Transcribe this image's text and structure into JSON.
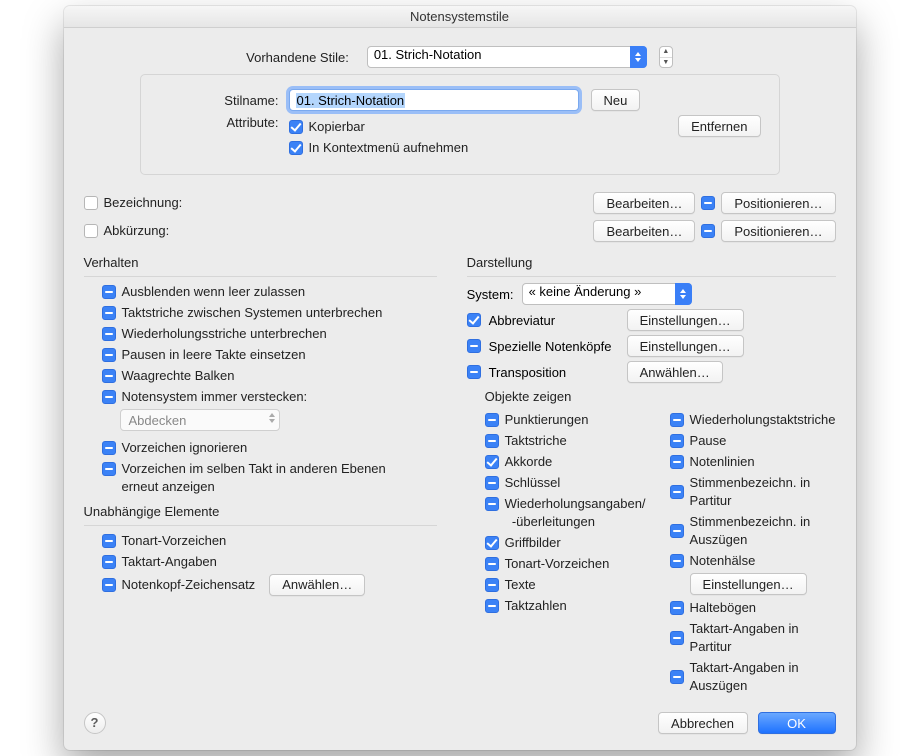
{
  "title": "Notensystemstile",
  "top": {
    "existing_label": "Vorhandene Stile:",
    "existing_value": "01.  Strich-Notation",
    "stylename_label": "Stilname:",
    "stylename_value": "01.  Strich-Notation",
    "new_btn": "Neu",
    "attributes_label": "Attribute:",
    "copyable": "Kopierbar",
    "contextmenu": "In Kontextmenü aufnehmen",
    "remove_btn": "Entfernen"
  },
  "names": {
    "bezeichnung": "Bezeichnung:",
    "abkuerzung": "Abkürzung:",
    "edit_btn": "Bearbeiten…",
    "position_btn": "Positionieren…"
  },
  "verhalten": {
    "heading": "Verhalten",
    "items": [
      "Ausblenden wenn leer zulassen",
      "Taktstriche zwischen Systemen unterbrechen",
      "Wiederholungsstriche unterbrechen",
      "Pausen in leere Takte einsetzen",
      "Waagrechte Balken",
      "Notensystem immer verstecken:"
    ],
    "hide_mode": "Abdecken",
    "ignore_acc": "Vorzeichen ignorieren",
    "redisplay_acc": "Vorzeichen im selben Takt in anderen Ebenen erneut anzeigen"
  },
  "unabhaengig": {
    "heading": "Unabhängige Elemente",
    "items": [
      "Tonart-Vorzeichen",
      "Taktart-Angaben",
      "Notenkopf-Zeichensatz"
    ],
    "select_btn": "Anwählen…"
  },
  "darstellung": {
    "heading": "Darstellung",
    "system_label": "System:",
    "system_value": "« keine Änderung »",
    "abbrev": "Abbreviatur",
    "settings_btn": "Einstellungen…",
    "special_heads": "Spezielle Notenköpfe",
    "transposition": "Transposition",
    "select_btn": "Anwählen…",
    "objects_heading": "Objekte zeigen",
    "left": [
      "Punktierungen",
      "Taktstriche",
      "Akkorde",
      "Schlüssel",
      "Wiederholungsangaben/-überleitungen",
      "Griffbilder",
      "Tonart-Vorzeichen",
      "Texte",
      "Taktzahlen"
    ],
    "left_state": [
      "mixed",
      "mixed",
      "checked",
      "mixed",
      "mixed",
      "checked",
      "mixed",
      "mixed",
      "mixed"
    ],
    "right": [
      "Wiederholungstaktstriche",
      "Pause",
      "Notenlinien",
      "Stimmenbezeichn. in Partitur",
      "Stimmenbezeichn. in Auszügen",
      "Notenhälse",
      "Haltebögen",
      "Taktart-Angaben in Partitur",
      "Taktart-Angaben in Auszügen"
    ],
    "right_state": [
      "mixed",
      "mixed",
      "mixed",
      "mixed",
      "mixed",
      "mixed",
      "mixed",
      "mixed",
      "mixed"
    ],
    "stems_settings": "Einstellungen…"
  },
  "buttons": {
    "cancel": "Abbrechen",
    "ok": "OK"
  }
}
